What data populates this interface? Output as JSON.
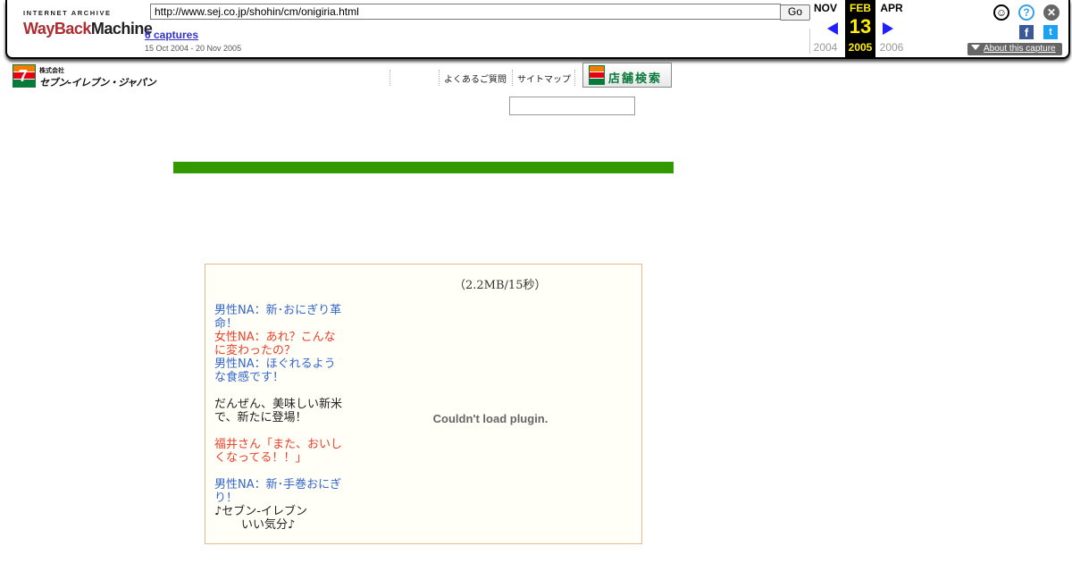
{
  "wayback": {
    "logo_top": "INTERNET ARCHIVE",
    "logo_wayback": "WayBack",
    "logo_machine": "Machine",
    "url": "http://www.sej.co.jp/shohin/cm/onigiria.html",
    "go_label": "Go",
    "captures": "6 captures",
    "range": "15 Oct 2004 - 20 Nov 2005",
    "months": {
      "prev": "NOV",
      "current": "FEB",
      "next": "APR"
    },
    "day": "13",
    "years": {
      "prev": "2004",
      "current": "2005",
      "next": "2006"
    },
    "about_label": "About this capture",
    "icons": {
      "user": "user-icon",
      "help": "help-icon",
      "close": "close-icon",
      "facebook": "facebook-icon",
      "twitter": "twitter-icon"
    }
  },
  "site": {
    "logo_corp": "株式会社",
    "logo_name": "セブン-イレブン・ジャパン",
    "nav": {
      "faq": "よくあるご質問",
      "sitemap": "サイトマップ",
      "store_search": "店舗検索"
    },
    "search": {
      "value": ""
    },
    "colors": {
      "green_bar": "#339900",
      "blue_text": "#3366cc",
      "red_text": "#e8412c"
    }
  },
  "cm": {
    "size_label": "（2.2MB/15秒）",
    "plugin_message": "Couldn't load plugin.",
    "script": [
      {
        "speaker_class": "blue",
        "text": "男性NA：新･おにぎり革命！"
      },
      {
        "speaker_class": "red",
        "text": "女性NA：あれ？こんなに変わったの？"
      },
      {
        "speaker_class": "blue",
        "text": "男性NA：ほぐれるような食感です！"
      },
      {
        "speaker_class": "black",
        "text": "だんぜん、美味しい新米で、新たに登場！"
      },
      {
        "speaker_class": "red",
        "text": "福井さん「また、おいしくなってる！！」"
      },
      {
        "speaker_class": "blue",
        "text": "男性NA：新･手巻おにぎり！"
      },
      {
        "speaker_class": "black",
        "text": "♪セブン-イレブン"
      },
      {
        "speaker_class": "black",
        "text": "いい気分♪"
      }
    ]
  }
}
